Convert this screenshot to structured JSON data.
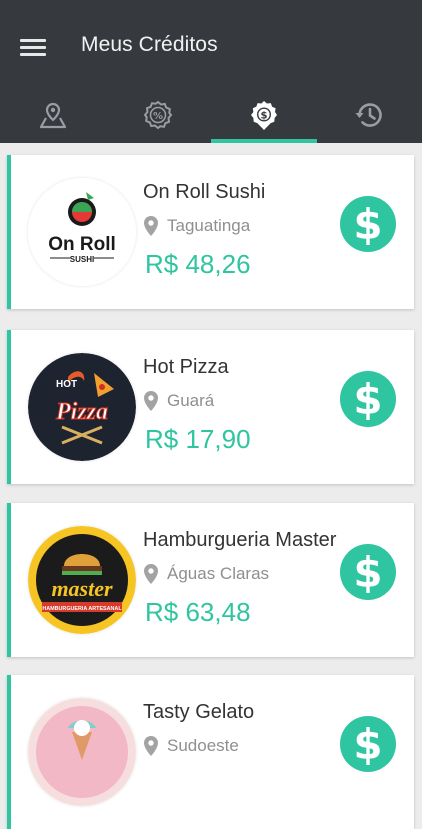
{
  "header": {
    "title": "Meus Créditos"
  },
  "tabs": [
    {
      "icon": "map-pin-icon",
      "active": false
    },
    {
      "icon": "discount-badge-icon",
      "active": false
    },
    {
      "icon": "credit-badge-icon",
      "active": true
    },
    {
      "icon": "history-clock-icon",
      "active": false
    }
  ],
  "accent_color": "#2fc5a0",
  "header_color": "#363a3f",
  "credits": [
    {
      "name": "On Roll Sushi",
      "location": "Taguatinga",
      "amount": "R$ 48,26",
      "logo_text": "On Roll",
      "logo_subtext": "SUSHI"
    },
    {
      "name": "Hot Pizza",
      "location": "Guará",
      "amount": "R$ 17,90",
      "logo_text": "Pizza",
      "logo_subtext": "HOT"
    },
    {
      "name": "Hamburgueria Master",
      "location": "Águas Claras",
      "amount": "R$ 63,48",
      "logo_text": "master",
      "logo_subtext": "HAMBURGUERIA ARTESANAL"
    },
    {
      "name": "Tasty Gelato",
      "location": "Sudoeste",
      "amount": "",
      "logo_text": "",
      "logo_subtext": ""
    }
  ]
}
